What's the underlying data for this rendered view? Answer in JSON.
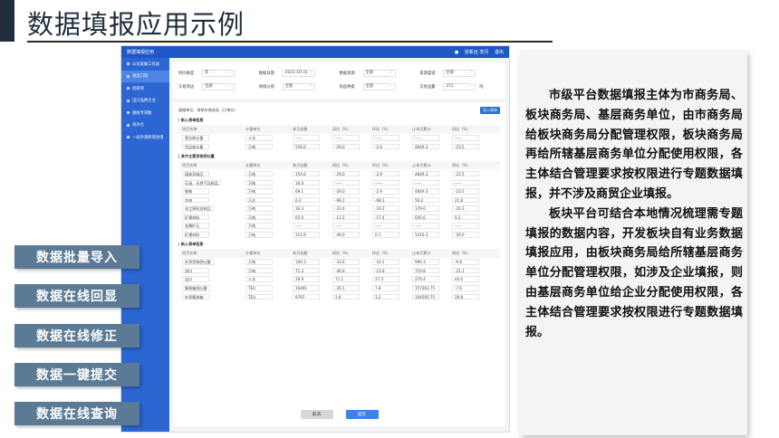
{
  "slide": {
    "title": "数据填报应用示例",
    "features": [
      "数据批量导入",
      "数据在线回显",
      "数据在线修正",
      "数据一键提交",
      "数据在线查询"
    ],
    "paragraphs": [
      "市级平台数据填报主体为市商务局、板块商务局、基层商务单位，由市商务局给板块商务局分配管理权限，板块商务局再给所辖基层商务单位分配使用权限，各主体结合管理要求按权限进行专题数据填报，并不涉及商贸企业填报。",
      "板块平台可结合本地情况梳理需专题填报的数据内容，开发板块自有业务数据填报应用，由板块商务局给所辖基层商务单位分配管理权限，如涉及企业填报，则由基层商务单位给企业分配使用权限，各主体结合管理要求按权限进行专题数据填报。"
    ]
  },
  "app": {
    "title": "数据填报应用",
    "user": "张新远  李丹",
    "logout": "退出",
    "sidebar": [
      "公司发展工作站",
      "进出口项",
      "招商项",
      "出口品牌企业",
      "税收专项数",
      "海外仓",
      "一站外港跨境进境"
    ],
    "sidebar_active": 1,
    "filters": [
      [
        [
          "时间维度",
          "年"
        ],
        [
          "数据日期",
          "2021-10-31"
        ],
        [
          "数据来源",
          "全部"
        ],
        [
          "来源渠道",
          "全部"
        ]
      ],
      [
        [
          "交易周边",
          "全部"
        ],
        [
          "地域分部",
          "全部"
        ],
        [
          "商品种类",
          "全部"
        ],
        [
          "交易品量",
          "371"
        ]
      ]
    ],
    "filter_tail": "吨",
    "table_header": "填报单位：常熟市商务局（已审办）",
    "export_label": "导入表单",
    "columns": [
      "项目名称",
      "计量单位",
      "本月金额",
      "同比（%）",
      "环比（%）",
      "止本月累计",
      "同比（%）"
    ],
    "sections": [
      {
        "title": "| 新入表单信息",
        "rows": [
          [
            "营业商计量",
            "人次",
            "-----",
            "-----",
            "-----",
            "-----",
            "-----"
          ],
          [
            "货运商计量",
            "万吨",
            "558.6",
            "-29.0",
            "-2.6",
            "4849.3",
            "-23.5"
          ]
        ]
      },
      {
        "title": "| 其中主要货物吞吐量",
        "rows": [
          [
            "煤炭及制品",
            "万吨",
            "154.6",
            "-29.0",
            "-2.9",
            "4849.3",
            "-23.5"
          ],
          [
            "石油、天然气及制品",
            "万吨",
            "16.4",
            "-----",
            "-----",
            "-----",
            "-----"
          ],
          [
            "钢铁",
            "万吨",
            "69.1",
            "-29.0",
            "-2.9",
            "4849.3",
            "-23.5"
          ],
          [
            "木材",
            "万方",
            "0.3",
            "-99.1",
            "-98.1",
            "56.2",
            "21.8"
          ],
          [
            "化工原料及制品",
            "万吨",
            "36.3",
            "-31.6",
            "-19.2",
            "379.6",
            "-20.3"
          ],
          [
            "矿建材料",
            "万吨",
            "65.0",
            "-11.2",
            "-17.4",
            "605.6",
            "0.3"
          ],
          [
            "金属矿石",
            "万吨",
            "-----",
            "-----",
            "-----",
            "-----",
            "-----"
          ],
          [
            "矿建材料",
            "万吨",
            "212.9",
            "-49.0",
            "0.1",
            "1416.3",
            "-30.0"
          ]
        ]
      },
      {
        "title": "| 新入表单信息",
        "rows": [
          [
            "外贸货物吞吐量",
            "万吨",
            "100.3",
            "-33.6",
            "-10.1",
            "990.3",
            "-9.8"
          ],
          [
            "进口",
            "万吨",
            "71.3",
            "-46.8",
            "-23.8",
            "719.8",
            "-21.1"
          ],
          [
            "出口",
            "人次",
            "28.9",
            "71.1",
            "27.3",
            "270.4",
            "44.0"
          ],
          [
            "集装箱吞吐量",
            "TEU",
            "16491",
            "-26.1",
            "7.8",
            "157263.75",
            "-7.6"
          ],
          [
            "外贸集装箱",
            "TEU",
            "9797",
            "2.6",
            "3.2",
            "104595.75",
            "20.8"
          ]
        ]
      }
    ],
    "buttons": {
      "cancel": "取消",
      "submit": "提交"
    }
  }
}
